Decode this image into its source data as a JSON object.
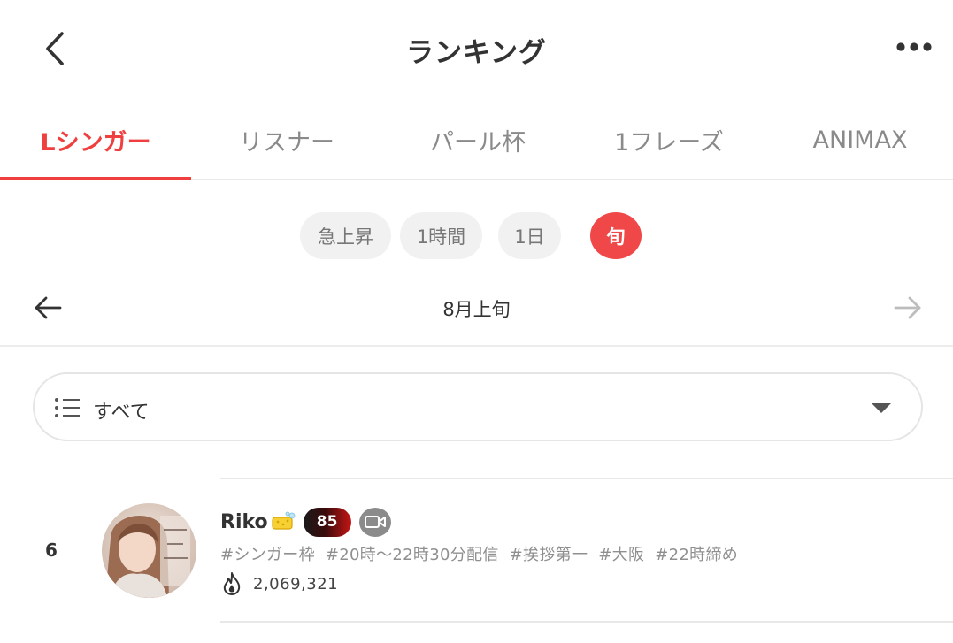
{
  "header": {
    "title": "ランキング",
    "back_icon": "chevron-left-icon",
    "more_icon": "more-horizontal-icon"
  },
  "tabs": [
    {
      "label": "Lシンガー",
      "active": true
    },
    {
      "label": "リスナー",
      "active": false
    },
    {
      "label": "パール杯",
      "active": false
    },
    {
      "label": "1フレーズ",
      "active": false
    },
    {
      "label": "ANIMAX",
      "active": false
    }
  ],
  "periods": [
    {
      "label": "急上昇",
      "active": false
    },
    {
      "label": "1時間",
      "active": false
    },
    {
      "label": "1日",
      "active": false
    },
    {
      "label": "旬",
      "active": true
    }
  ],
  "date_nav": {
    "label": "8月上旬",
    "prev_icon": "arrow-left-icon",
    "next_icon": "arrow-right-icon"
  },
  "filter": {
    "label": "すべて",
    "icon": "list-icon",
    "caret_icon": "caret-down-icon"
  },
  "ranking": [
    {
      "rank": "6",
      "name": "Riko",
      "level": "85",
      "tags": [
        "#シンガー枠",
        "#20時〜22時30分配信",
        "#挨拶第一",
        "#大阪",
        "#22時締め"
      ],
      "points": "2,069,321"
    }
  ],
  "colors": {
    "accent": "#ef3f3f",
    "inactive_tab": "#8a8a8a",
    "pill_bg": "#f1f1f1"
  }
}
